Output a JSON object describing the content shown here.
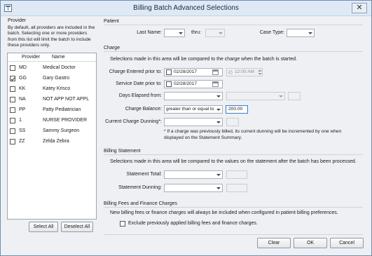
{
  "window": {
    "title": "Billing Batch Advanced Selections",
    "close_glyph": "✕"
  },
  "provider": {
    "header": "Provider",
    "description": "By default, all providers are included in the batch. Selecting one or more providers from this list will limit the batch to include these providers only.",
    "columns": [
      "Provider",
      "Name"
    ],
    "rows": [
      {
        "code": "MD",
        "name": "Medical  Doctor",
        "checked": false
      },
      {
        "code": "GG",
        "name": "Gary Gastro",
        "checked": true
      },
      {
        "code": "KK",
        "name": "Katey Krisco",
        "checked": false
      },
      {
        "code": "NA",
        "name": "NOT APP NOT APPL",
        "checked": false
      },
      {
        "code": "PP",
        "name": "Patty Pediatrician",
        "checked": false
      },
      {
        "code": "1",
        "name": "NURSE PROVIDER",
        "checked": false
      },
      {
        "code": "SS",
        "name": "Sammy Surgeon",
        "checked": false
      },
      {
        "code": "ZZ",
        "name": "Zelda Zebra",
        "checked": false
      }
    ],
    "select_all": "Select All",
    "deselect_all": "Deselect All"
  },
  "patient": {
    "header": "Patient",
    "last_name_label": "Last Name:",
    "thru_label": "thru:",
    "case_type_label": "Case Type:"
  },
  "charge": {
    "header": "Charge",
    "description": "Selections made in this area will be compared to the charge when the batch is started.",
    "entered_label": "Charge Entered prior to:",
    "entered_date": "02/28/2017",
    "entered_time": "12:00 AM",
    "service_label": "Service Date prior to:",
    "service_date": "02/28/2017",
    "days_label": "Days Elapsed from:",
    "balance_label": "Charge Balance:",
    "balance_operator": "greater than or equal to",
    "balance_value": "200.00",
    "dunning_label": "Current Charge Dunning*:",
    "dunning_note": "* If a charge was previously billed, its current dunning will be incremented by one when displayed on the Statement Summary."
  },
  "statement": {
    "header": "Billing Statement",
    "description": "Selections made in this area will be compared to the values on the statement after the batch has been processed.",
    "total_label": "Statement Total:",
    "dunning_label": "Statement Dunning:"
  },
  "fees": {
    "header": "Billing Fees and Finance Charges",
    "description": "New billing fees or finance charges will always be included when configured in patient billing preferences.",
    "exclude_label": "Exclude previously applied billing fees and finance charges."
  },
  "buttons": {
    "clear": "Clear",
    "ok": "OK",
    "cancel": "Cancel"
  }
}
